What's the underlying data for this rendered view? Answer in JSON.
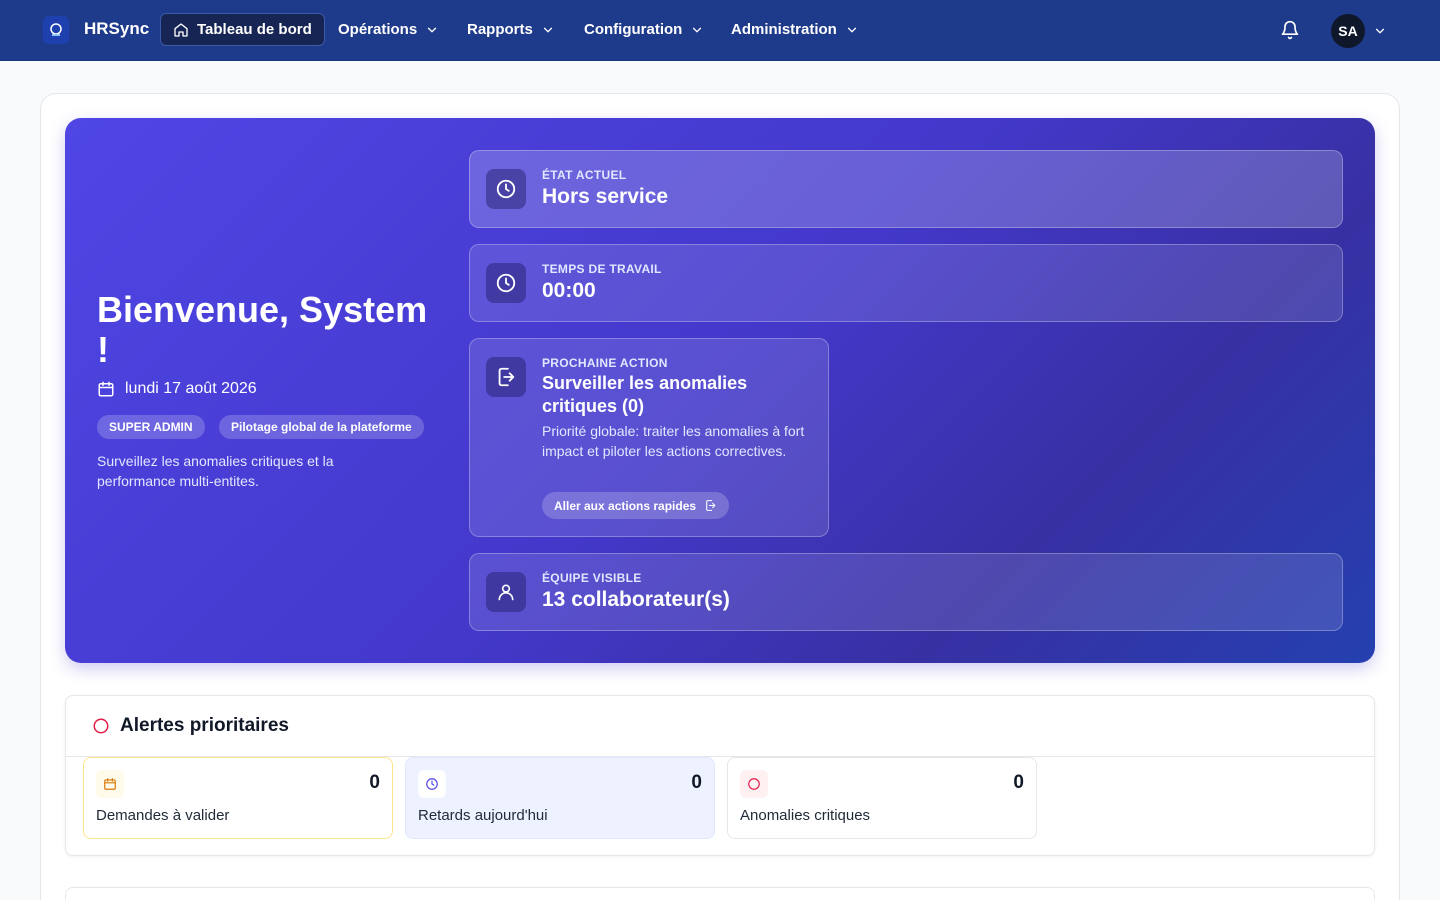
{
  "app": {
    "brand": "HRSync"
  },
  "nav": {
    "dashboard": "Tableau de bord",
    "operations": "Opérations",
    "reports": "Rapports",
    "configuration": "Configuration",
    "administration": "Administration"
  },
  "user": {
    "initials": "SA"
  },
  "hero": {
    "title": "Bienvenue, System !",
    "date": "lundi 17 août 2026",
    "role_badge": "SUPER ADMIN",
    "scope_badge": "Pilotage global de la plateforme",
    "description": "Surveillez les anomalies critiques et la performance multi-entites."
  },
  "stats": {
    "state": {
      "label": "ÉTAT ACTUEL",
      "value": "Hors service"
    },
    "work_time": {
      "label": "TEMPS DE TRAVAIL",
      "value": "00:00"
    },
    "next_action": {
      "label": "PROCHAINE ACTION",
      "title": "Surveiller les anomalies critiques (0)",
      "description": "Priorité globale: traiter les anomalies à fort impact et piloter les actions correctives.",
      "button": "Aller aux actions rapides"
    },
    "team": {
      "label": "ÉQUIPE VISIBLE",
      "value": "13 collaborateur(s)"
    }
  },
  "alerts": {
    "title": "Alertes prioritaires",
    "items": [
      {
        "label": "Demandes à valider",
        "count": "0",
        "icon": "calendar-icon",
        "color": "#d97706"
      },
      {
        "label": "Retards aujourd'hui",
        "count": "0",
        "icon": "clock-icon",
        "color": "#4f46e5"
      },
      {
        "label": "Anomalies critiques",
        "count": "0",
        "icon": "alert-circle-icon",
        "color": "#e11d48"
      }
    ]
  },
  "colors": {
    "nav_bg": "#1e3a8a",
    "hero_start": "#4f46e5",
    "hero_end": "#3730a3",
    "danger": "#e11d48"
  }
}
